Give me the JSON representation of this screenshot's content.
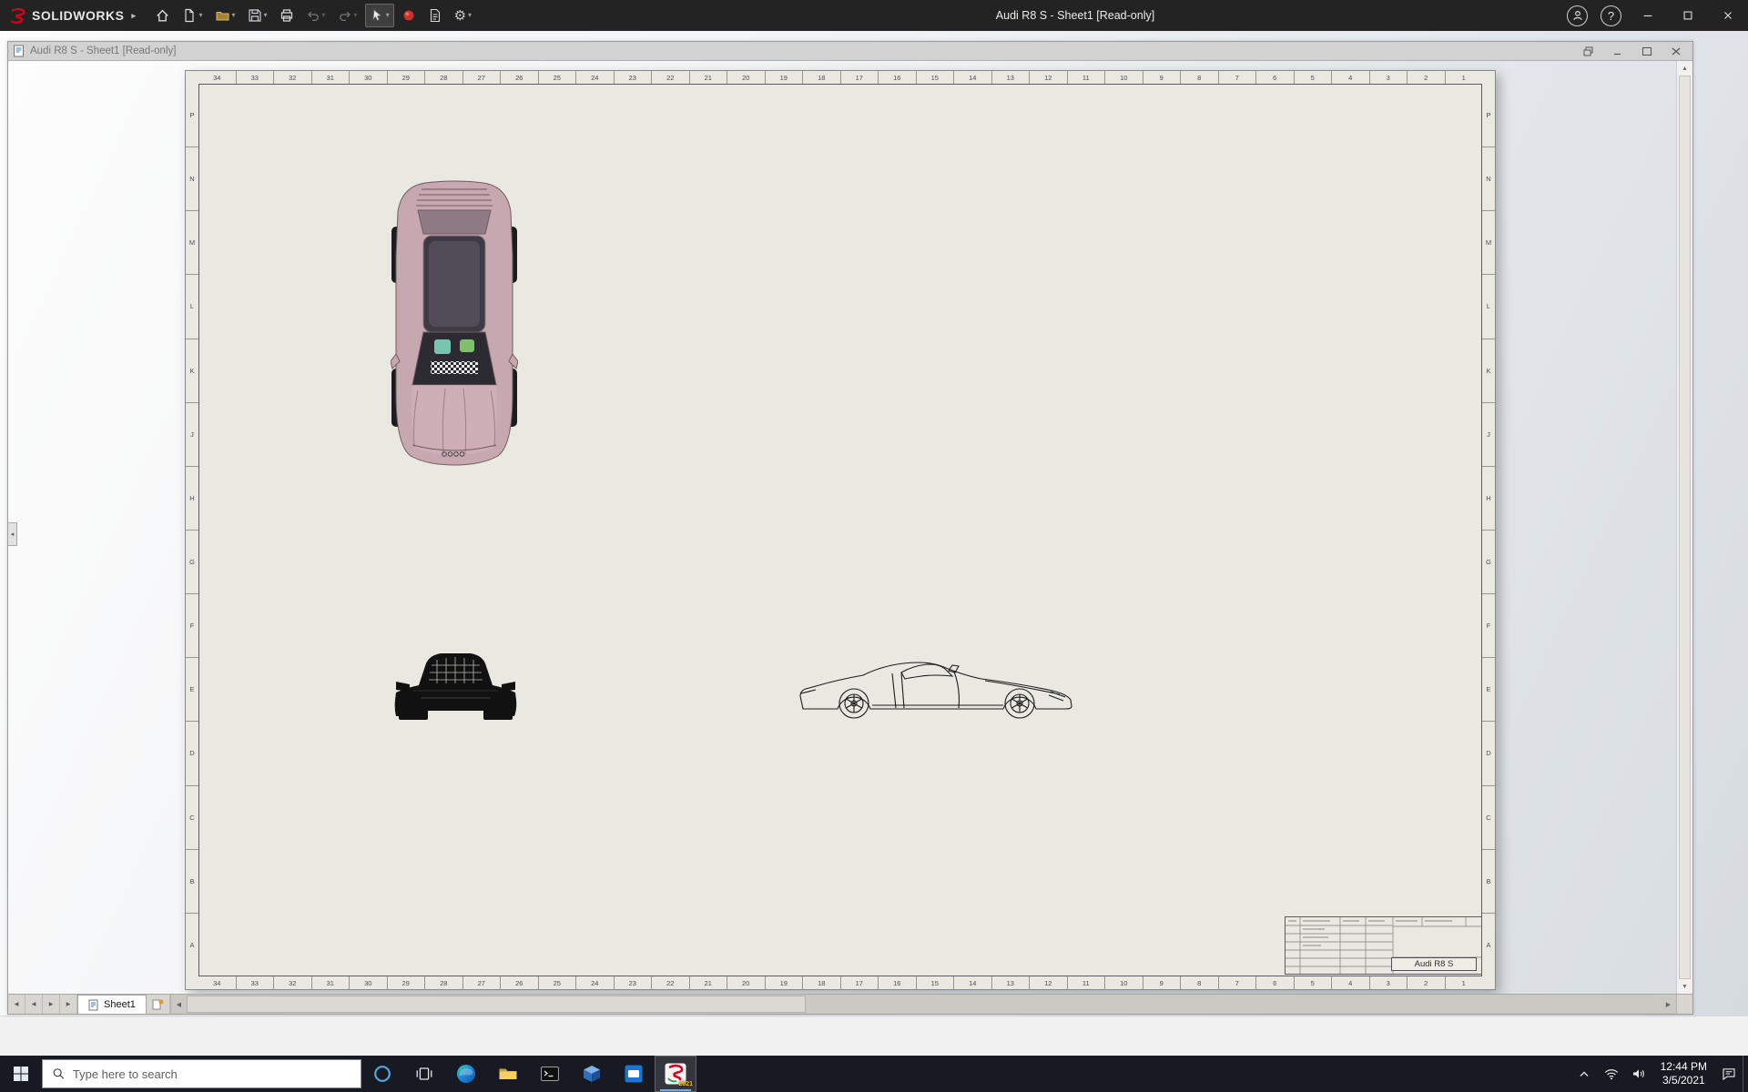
{
  "app": {
    "titlebar": {
      "logo_text": "SOLIDWORKS",
      "title": "Audi R8 S - Sheet1 [Read-only]"
    }
  },
  "doc_window": {
    "title": "Audi R8 S - Sheet1 [Read-only]"
  },
  "sheet": {
    "zone_columns": [
      "34",
      "33",
      "32",
      "31",
      "30",
      "29",
      "28",
      "27",
      "26",
      "25",
      "24",
      "23",
      "22",
      "21",
      "20",
      "19",
      "18",
      "17",
      "16",
      "15",
      "14",
      "13",
      "12",
      "11",
      "10",
      "9",
      "8",
      "7",
      "6",
      "5",
      "4",
      "3",
      "2",
      "1"
    ],
    "zone_rows": [
      "P",
      "N",
      "M",
      "L",
      "K",
      "J",
      "H",
      "G",
      "F",
      "E",
      "D",
      "C",
      "B",
      "A"
    ],
    "title_block": {
      "model_name": "Audi R8 S"
    }
  },
  "status_bar": {
    "sheet_tab_label": "Sheet1"
  },
  "taskbar": {
    "search_placeholder": "Type here to search",
    "clock_time": "12:44 PM",
    "clock_date": "3/5/2021",
    "solidworks_badge": "2021"
  },
  "icons": {
    "dropdown_caret": "▾",
    "expand_arrow": "▸",
    "gear": "⚙",
    "help": "?",
    "scroll_left": "◀",
    "scroll_right": "▶",
    "scroll_up": "▲",
    "scroll_down": "▼",
    "collapse_left": "◂"
  },
  "colors": {
    "accent_red": "#d6001c",
    "paper": "#e9e9e1"
  }
}
